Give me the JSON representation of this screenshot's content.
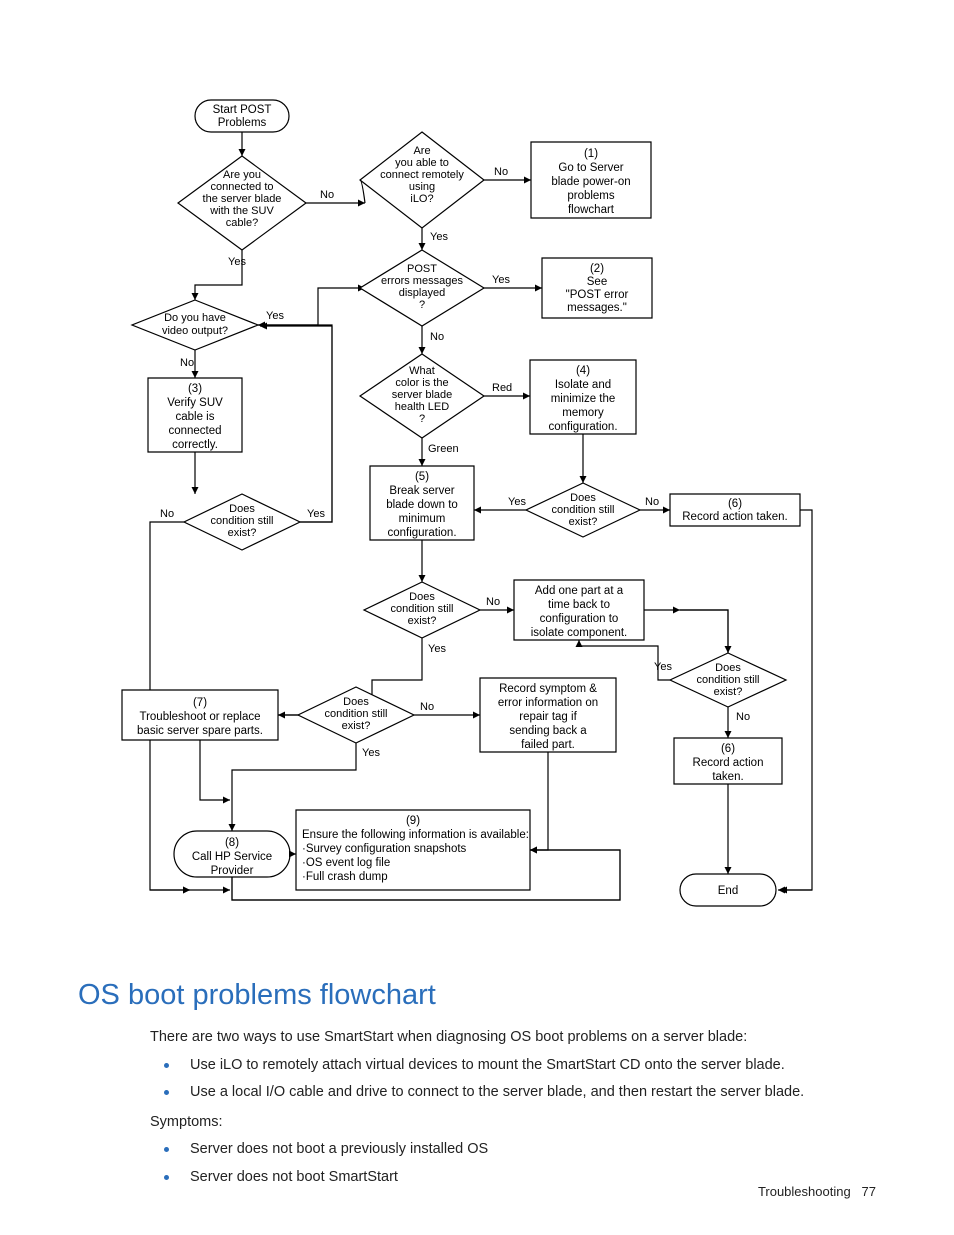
{
  "heading": "OS boot problems flowchart",
  "intro": "There are two ways to use SmartStart when diagnosing OS boot problems on a server blade:",
  "bullets1": [
    "Use iLO to remotely attach virtual devices to mount the SmartStart CD onto the server blade.",
    "Use a local I/O cable and drive to connect to the server blade, and then restart the server blade."
  ],
  "symptoms_label": "Symptoms:",
  "bullets2": [
    "Server does not boot a previously installed OS",
    "Server does not boot SmartStart"
  ],
  "footer_section": "Troubleshooting",
  "footer_page": "77",
  "labels": {
    "yes": "Yes",
    "no": "No",
    "red": "Red",
    "green": "Green"
  },
  "nodes": {
    "start": [
      "Start POST",
      "Problems"
    ],
    "d_suv": [
      "Are you",
      "connected to",
      "the server blade",
      "with the SUV",
      "cable?"
    ],
    "d_ilo": [
      "Are",
      "you able to",
      "connect remotely",
      "using",
      "iLO?"
    ],
    "r1": [
      "(1)",
      "Go to Server",
      "blade power-on",
      "problems",
      "flowchart"
    ],
    "d_video": [
      "Do you have",
      "video output?"
    ],
    "d_post": [
      "POST",
      "errors messages",
      "displayed",
      "?"
    ],
    "r2": [
      "(2)",
      "See",
      "\"POST error",
      "messages.\""
    ],
    "r3": [
      "(3)",
      "Verify SUV",
      "cable is",
      "connected",
      "correctly."
    ],
    "d_led": [
      "What",
      "color is the",
      "server blade",
      "health LED",
      "?"
    ],
    "r4": [
      "(4)",
      "Isolate and",
      "minimize the",
      "memory",
      "configuration."
    ],
    "d_cond_left": [
      "Does",
      "condition still",
      "exist?"
    ],
    "r5": [
      "(5)",
      "Break server",
      "blade down to",
      "minimum",
      "configuration."
    ],
    "d_cond_mem": [
      "Does",
      "condition still",
      "exist?"
    ],
    "r6a": [
      "(6)",
      "Record action taken."
    ],
    "d_cond_min": [
      "Does",
      "condition still",
      "exist?"
    ],
    "r_addpart": [
      "Add one part at a",
      "time back to",
      "configuration to",
      "isolate component."
    ],
    "r7": [
      "(7)",
      "Troubleshoot or replace",
      "basic server spare parts."
    ],
    "d_cond_7": [
      "Does",
      "condition still",
      "exist?"
    ],
    "r_record_symptom": [
      "Record symptom &",
      "error information on",
      "repair tag if",
      "sending back a",
      "failed part."
    ],
    "d_cond_iso": [
      "Does",
      "condition still",
      "exist?"
    ],
    "r6b": [
      "(6)",
      "Record action",
      "taken."
    ],
    "r8": [
      "(8)",
      "Call HP Service",
      "Provider"
    ],
    "r9": [
      "(9)",
      "Ensure the following information is available:",
      "·Survey configuration snapshots",
      "·OS event log file",
      "·Full crash dump"
    ],
    "end": [
      "End"
    ]
  }
}
